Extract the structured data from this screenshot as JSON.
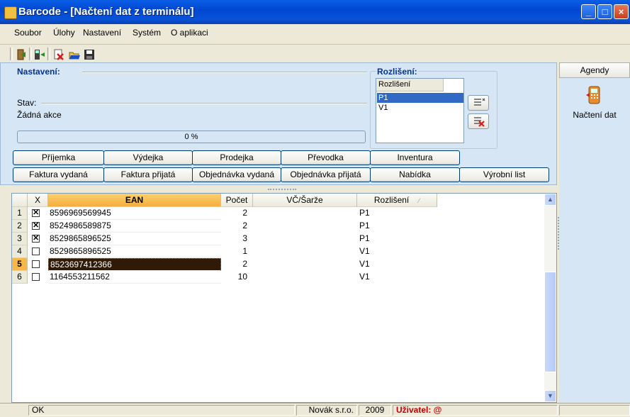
{
  "window": {
    "title": "Barcode - [Načtení dat z terminálu]"
  },
  "menu": [
    "Soubor",
    "Úlohy",
    "Nastavení",
    "Systém",
    "O aplikaci"
  ],
  "settings": {
    "nastaveni_label": "Nastavení:",
    "stav_label": "Stav:",
    "stav_value": "Žádná akce",
    "progress": "0 %",
    "progress_value": 0
  },
  "rozliseni": {
    "label": "Rozlišení:",
    "header": "Rozlišení",
    "items": [
      "P1",
      "V1"
    ],
    "selected": "P1"
  },
  "buttons_row1": [
    "Příjemka",
    "Výdejka",
    "Prodejka",
    "Převodka",
    "Inventura"
  ],
  "buttons_row2": [
    "Faktura vydaná",
    "Faktura přijatá",
    "Objednávka vydaná",
    "Objednávka přijatá",
    "Nabídka",
    "Výrobní list"
  ],
  "grid": {
    "columns": [
      "X",
      "EAN",
      "Počet",
      "VČ/Šarže",
      "Rozlišení"
    ],
    "rows": [
      {
        "num": "1",
        "checked": true,
        "ean": "8596969569945",
        "pocet": "2",
        "sarze": "",
        "rozliseni": "P1"
      },
      {
        "num": "2",
        "checked": true,
        "ean": "8524986589875",
        "pocet": "2",
        "sarze": "",
        "rozliseni": "P1"
      },
      {
        "num": "3",
        "checked": true,
        "ean": "8529865896525",
        "pocet": "3",
        "sarze": "",
        "rozliseni": "P1"
      },
      {
        "num": "4",
        "checked": false,
        "ean": "8529865896525",
        "pocet": "1",
        "sarze": "",
        "rozliseni": "V1"
      },
      {
        "num": "5",
        "checked": false,
        "ean": "8523697412366",
        "pocet": "2",
        "sarze": "",
        "rozliseni": "V1",
        "selected": true
      },
      {
        "num": "6",
        "checked": false,
        "ean": "1164553211562",
        "pocet": "10",
        "sarze": "",
        "rozliseni": "V1"
      }
    ]
  },
  "sidebar": {
    "header": "Agendy",
    "item_label": "Načtení dat"
  },
  "status": {
    "state": "OK",
    "company": "Novák s.r.o.",
    "year": "2009",
    "user": "Uživatel: @"
  },
  "colors": {
    "title_blue": "#0047d0",
    "panel_bg": "#d6e6f4",
    "ean_header": "#f7b84a",
    "selected_cell": "#2e1a07",
    "user_red": "#c00000"
  }
}
